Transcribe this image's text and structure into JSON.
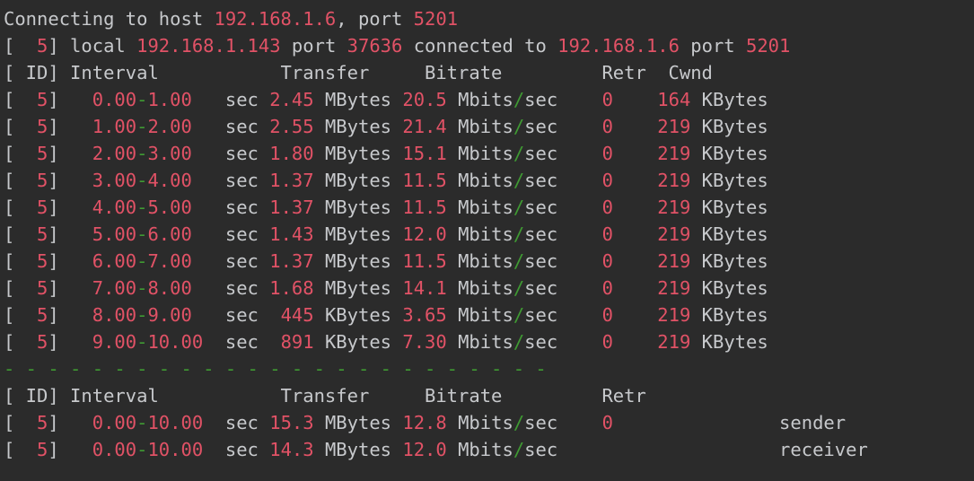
{
  "colors": {
    "background": "#2b2b2b",
    "text": "#c7c9cc",
    "number": "#e15266",
    "accent_green": "#3f9a33"
  },
  "header": {
    "connecting": {
      "prefix": "Connecting to host ",
      "host": "192.168.1.6",
      "mid": ", port ",
      "port": "5201"
    },
    "local": {
      "bracket_open": "[",
      "id": "  5",
      "bracket_close": "]",
      "t1": " local ",
      "local_ip": "192.168.1.143",
      "t2": " port ",
      "local_port": "37636",
      "t3": " connected to ",
      "remote_ip": "192.168.1.6",
      "t4": " port ",
      "remote_port": "5201"
    },
    "columns": "[ ID] Interval           Transfer     Bitrate         Retr  Cwnd"
  },
  "intervals": [
    {
      "id": "5",
      "start": "0.00",
      "end": "1.00",
      "unit": "sec",
      "transfer": "2.45",
      "transfer_unit": "MBytes",
      "bitrate": "20.5",
      "retr": "0",
      "cwnd": "164",
      "cwnd_unit": "KBytes"
    },
    {
      "id": "5",
      "start": "1.00",
      "end": "2.00",
      "unit": "sec",
      "transfer": "2.55",
      "transfer_unit": "MBytes",
      "bitrate": "21.4",
      "retr": "0",
      "cwnd": "219",
      "cwnd_unit": "KBytes"
    },
    {
      "id": "5",
      "start": "2.00",
      "end": "3.00",
      "unit": "sec",
      "transfer": "1.80",
      "transfer_unit": "MBytes",
      "bitrate": "15.1",
      "retr": "0",
      "cwnd": "219",
      "cwnd_unit": "KBytes"
    },
    {
      "id": "5",
      "start": "3.00",
      "end": "4.00",
      "unit": "sec",
      "transfer": "1.37",
      "transfer_unit": "MBytes",
      "bitrate": "11.5",
      "retr": "0",
      "cwnd": "219",
      "cwnd_unit": "KBytes"
    },
    {
      "id": "5",
      "start": "4.00",
      "end": "5.00",
      "unit": "sec",
      "transfer": "1.37",
      "transfer_unit": "MBytes",
      "bitrate": "11.5",
      "retr": "0",
      "cwnd": "219",
      "cwnd_unit": "KBytes"
    },
    {
      "id": "5",
      "start": "5.00",
      "end": "6.00",
      "unit": "sec",
      "transfer": "1.43",
      "transfer_unit": "MBytes",
      "bitrate": "12.0",
      "retr": "0",
      "cwnd": "219",
      "cwnd_unit": "KBytes"
    },
    {
      "id": "5",
      "start": "6.00",
      "end": "7.00",
      "unit": "sec",
      "transfer": "1.37",
      "transfer_unit": "MBytes",
      "bitrate": "11.5",
      "retr": "0",
      "cwnd": "219",
      "cwnd_unit": "KBytes"
    },
    {
      "id": "5",
      "start": "7.00",
      "end": "8.00",
      "unit": "sec",
      "transfer": "1.68",
      "transfer_unit": "MBytes",
      "bitrate": "14.1",
      "retr": "0",
      "cwnd": "219",
      "cwnd_unit": "KBytes"
    },
    {
      "id": "5",
      "start": "8.00",
      "end": "9.00",
      "unit": "sec",
      "transfer": "445",
      "transfer_unit": "KBytes",
      "bitrate": "3.65",
      "retr": "0",
      "cwnd": "219",
      "cwnd_unit": "KBytes"
    },
    {
      "id": "5",
      "start": "9.00",
      "end": "10.00",
      "unit": "sec",
      "transfer": "891",
      "transfer_unit": "KBytes",
      "bitrate": "7.30",
      "retr": "0",
      "cwnd": "219",
      "cwnd_unit": "KBytes"
    }
  ],
  "bitrate_unit": {
    "a": "Mbits",
    "slash": "/",
    "b": "sec"
  },
  "separator": "- - - - - - - - - - - - - - - - - - - - - - - - -",
  "summary": {
    "columns": "[ ID] Interval           Transfer     Bitrate         Retr",
    "rows": [
      {
        "id": "5",
        "start": "0.00",
        "end": "10.00",
        "unit": "sec",
        "transfer": "15.3",
        "transfer_unit": "MBytes",
        "bitrate": "12.8",
        "retr": "0",
        "role": "sender"
      },
      {
        "id": "5",
        "start": "0.00",
        "end": "10.00",
        "unit": "sec",
        "transfer": "14.3",
        "transfer_unit": "MBytes",
        "bitrate": "12.0",
        "retr": "",
        "role": "receiver"
      }
    ]
  }
}
